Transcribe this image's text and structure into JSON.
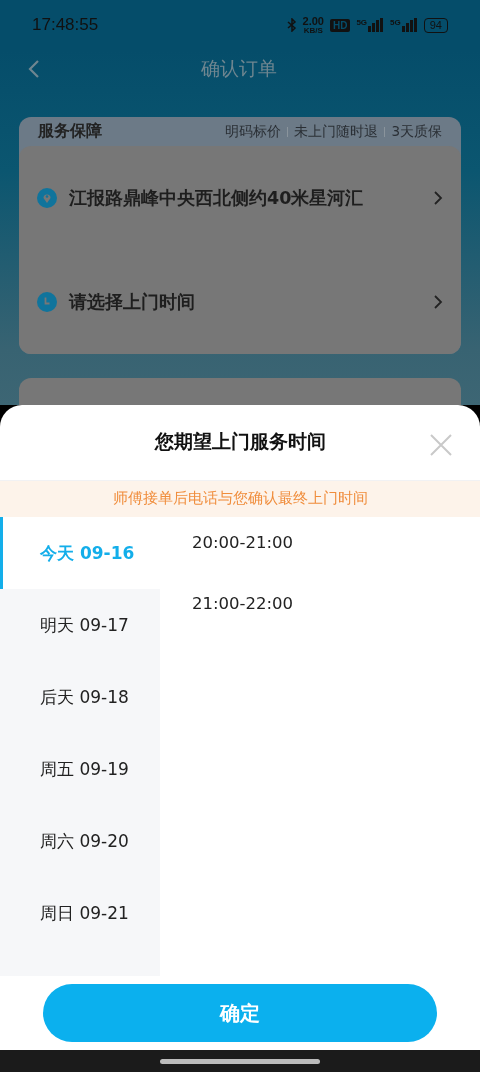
{
  "status_bar": {
    "time": "17:48:55",
    "net_speed": "2.00",
    "net_unit": "KB/S",
    "hd": "HD",
    "sim1": "5G",
    "sim2": "5G",
    "battery": "94"
  },
  "header": {
    "title": "确认订单"
  },
  "guarantee": {
    "title": "服务保障",
    "tags": [
      "明码标价",
      "未上门随时退",
      "3天质保"
    ]
  },
  "order_rows": [
    {
      "kind": "address",
      "text": "江报路鼎峰中央西北侧约40米星河汇"
    },
    {
      "kind": "time",
      "text": "请选择上门时间"
    }
  ],
  "sheet": {
    "title": "您期望上门服务时间",
    "notice": "师傅接单后电话与您确认最终上门时间",
    "days": [
      {
        "label": "今天 09-16",
        "selected": true
      },
      {
        "label": "明天 09-17",
        "selected": false
      },
      {
        "label": "后天 09-18",
        "selected": false
      },
      {
        "label": "周五 09-19",
        "selected": false
      },
      {
        "label": "周六 09-20",
        "selected": false
      },
      {
        "label": "周日 09-21",
        "selected": false
      }
    ],
    "slots": [
      "20:00-21:00",
      "21:00-22:00"
    ],
    "confirm": "确定"
  }
}
